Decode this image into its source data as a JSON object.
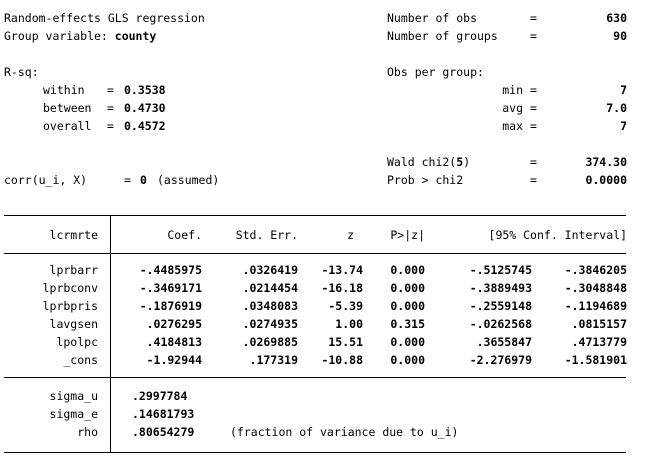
{
  "header": {
    "title": "Random-effects GLS regression",
    "group_var_label": "Group variable: ",
    "group_var": "county",
    "nobs_label": "Number of obs",
    "nobs": "630",
    "ngroups_label": "Number of groups",
    "ngroups": "90",
    "eq": "=",
    "rsq_label": "R-sq:",
    "within_label": "within",
    "within": "0.3538",
    "between_label": "between",
    "between": "0.4730",
    "overall_label": "overall",
    "overall": "0.4572",
    "obs_per_group_label": "Obs per group:",
    "min_label": "min",
    "min": "7",
    "avg_label": "avg",
    "avg": "7.0",
    "max_label": "max",
    "max": "7",
    "wald_label": "Wald chi2(",
    "wald_df": "5",
    "wald_close": ")",
    "wald": "374.30",
    "corr_label": "corr(u_i, X)",
    "corr_value": "0",
    "corr_note": "(assumed)",
    "prob_label": "Prob > chi2",
    "prob": "0.0000"
  },
  "table": {
    "depvar": "lcrmrte",
    "columns": [
      "Coef.",
      "Std. Err.",
      "z",
      "P>|z|",
      "[95% Conf. Interval]"
    ],
    "rows": [
      {
        "name": "lprbarr",
        "coef": "-.4485975",
        "se": ".0326419",
        "z": "-13.74",
        "p": "0.000",
        "lo": "-.5125745",
        "hi": "-.3846205"
      },
      {
        "name": "lprbconv",
        "coef": "-.3469171",
        "se": ".0214454",
        "z": "-16.18",
        "p": "0.000",
        "lo": "-.3889493",
        "hi": "-.3048848"
      },
      {
        "name": "lprbpris",
        "coef": "-.1876919",
        "se": ".0348083",
        "z": "-5.39",
        "p": "0.000",
        "lo": "-.2559148",
        "hi": "-.1194689"
      },
      {
        "name": "lavgsen",
        "coef": ".0276295",
        "se": ".0274935",
        "z": "1.00",
        "p": "0.315",
        "lo": "-.0262568",
        "hi": ".0815157"
      },
      {
        "name": "lpolpc",
        "coef": ".4184813",
        "se": ".0269885",
        "z": "15.51",
        "p": "0.000",
        "lo": ".3655847",
        "hi": ".4713779"
      },
      {
        "name": "_cons",
        "coef": "-1.92944",
        "se": ".177319",
        "z": "-10.88",
        "p": "0.000",
        "lo": "-2.276979",
        "hi": "-1.581901"
      }
    ],
    "sigma_u_label": "sigma_u",
    "sigma_u": ".2997784",
    "sigma_e_label": "sigma_e",
    "sigma_e": ".14681793",
    "rho_label": "rho",
    "rho": ".80654279",
    "rho_note": "(fraction of variance due to u_i)"
  }
}
